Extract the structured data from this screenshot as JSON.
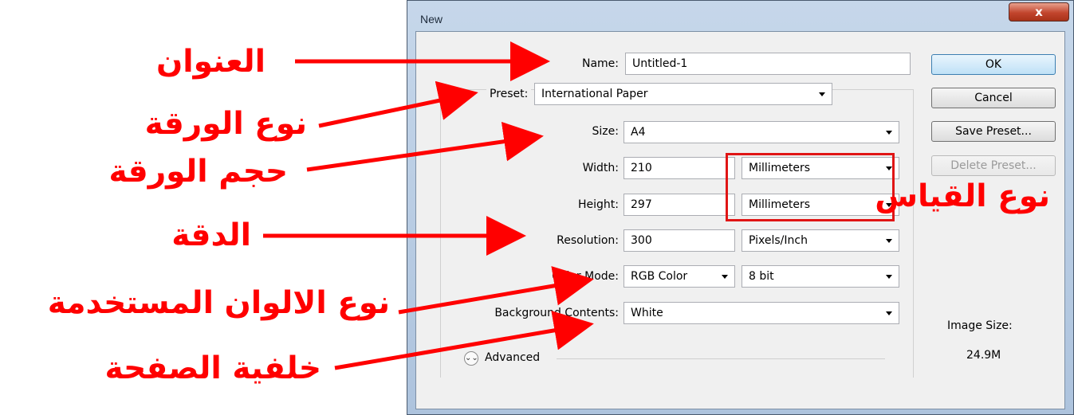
{
  "window": {
    "title": "New",
    "close_label": "x"
  },
  "fields": {
    "name": {
      "label": "Name:",
      "value": "Untitled-1"
    },
    "preset": {
      "label": "Preset:",
      "value": "International Paper"
    },
    "size": {
      "label": "Size:",
      "value": "A4"
    },
    "width": {
      "label": "Width:",
      "value": "210",
      "unit": "Millimeters"
    },
    "height": {
      "label": "Height:",
      "value": "297",
      "unit": "Millimeters"
    },
    "resolution": {
      "label": "Resolution:",
      "value": "300",
      "unit": "Pixels/Inch"
    },
    "color_mode": {
      "label": "Color Mode:",
      "value": "RGB Color",
      "depth": "8 bit"
    },
    "background": {
      "label": "Background Contents:",
      "value": "White"
    },
    "advanced_label": "Advanced"
  },
  "buttons": {
    "ok": "OK",
    "cancel": "Cancel",
    "save_preset": "Save Preset...",
    "delete_preset": "Delete Preset..."
  },
  "image_size": {
    "label": "Image Size:",
    "value": "24.9M"
  },
  "annotations": {
    "title": "العنوان",
    "paper_type": "نوع الورقة",
    "paper_size": "حجم الورقة",
    "measure_type": "نوع القياس",
    "resolution": "الدقة",
    "color_type": "نوع الالوان المستخدمة",
    "background": "خلفية الصفحة"
  },
  "colors": {
    "annotation": "#ff0000",
    "dialog_bg": "#f0f0f0",
    "title_bar": "#b9cde4"
  },
  "icons": {
    "close": "close-icon",
    "dropdown": "chevron-down-icon",
    "advanced": "double-chevron-icon"
  }
}
